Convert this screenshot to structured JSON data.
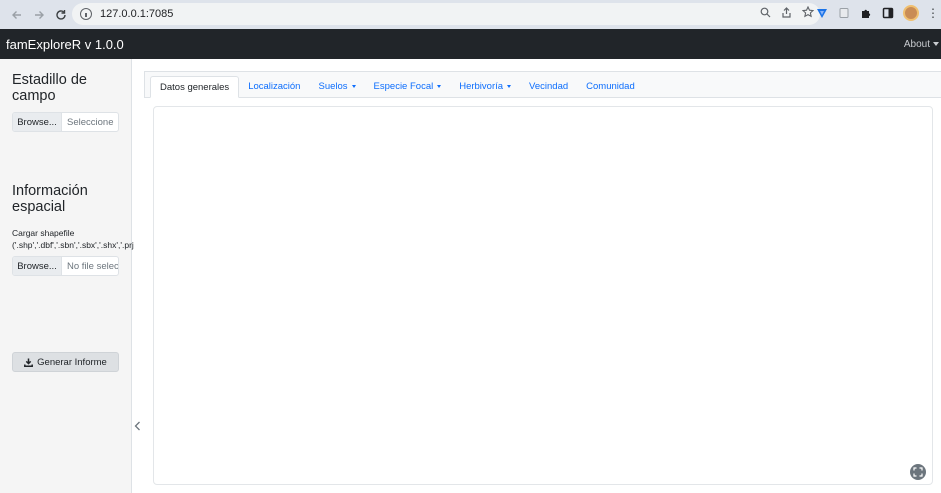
{
  "browser": {
    "url": "127.0.0.1:7085",
    "colors": {
      "chrome_bg": "#dee3eb",
      "urlbar_bg": "#f1f3f4"
    }
  },
  "navbar": {
    "brand": "famExploreR v 1.0.0",
    "about_label": "About"
  },
  "sidebar": {
    "section1_title": "Estadillo de campo",
    "field_file": {
      "button": "Browse...",
      "placeholder": "Seleccione"
    },
    "section2_title_line1": "Información",
    "section2_title_line2": "espacial",
    "shapefile_label_line1": "Cargar shapefile",
    "shapefile_label_line2": "('.shp','.dbf','.sbn','.sbx','.shx','.prj",
    "shape_file": {
      "button": "Browse...",
      "placeholder": "No file selected"
    },
    "generate_button": "Generar Informe"
  },
  "tabs": [
    {
      "label": "Datos generales",
      "active": true,
      "dropdown": false
    },
    {
      "label": "Localización",
      "active": false,
      "dropdown": false
    },
    {
      "label": "Suelos",
      "active": false,
      "dropdown": true
    },
    {
      "label": "Especie Focal",
      "active": false,
      "dropdown": true
    },
    {
      "label": "Herbivoría",
      "active": false,
      "dropdown": true
    },
    {
      "label": "Vecindad",
      "active": false,
      "dropdown": false
    },
    {
      "label": "Comunidad",
      "active": false,
      "dropdown": false
    }
  ],
  "colors": {
    "navbar_bg": "#212529",
    "sidebar_bg": "#f5f5f5",
    "link": "#0d6efd",
    "text": "#212529"
  }
}
